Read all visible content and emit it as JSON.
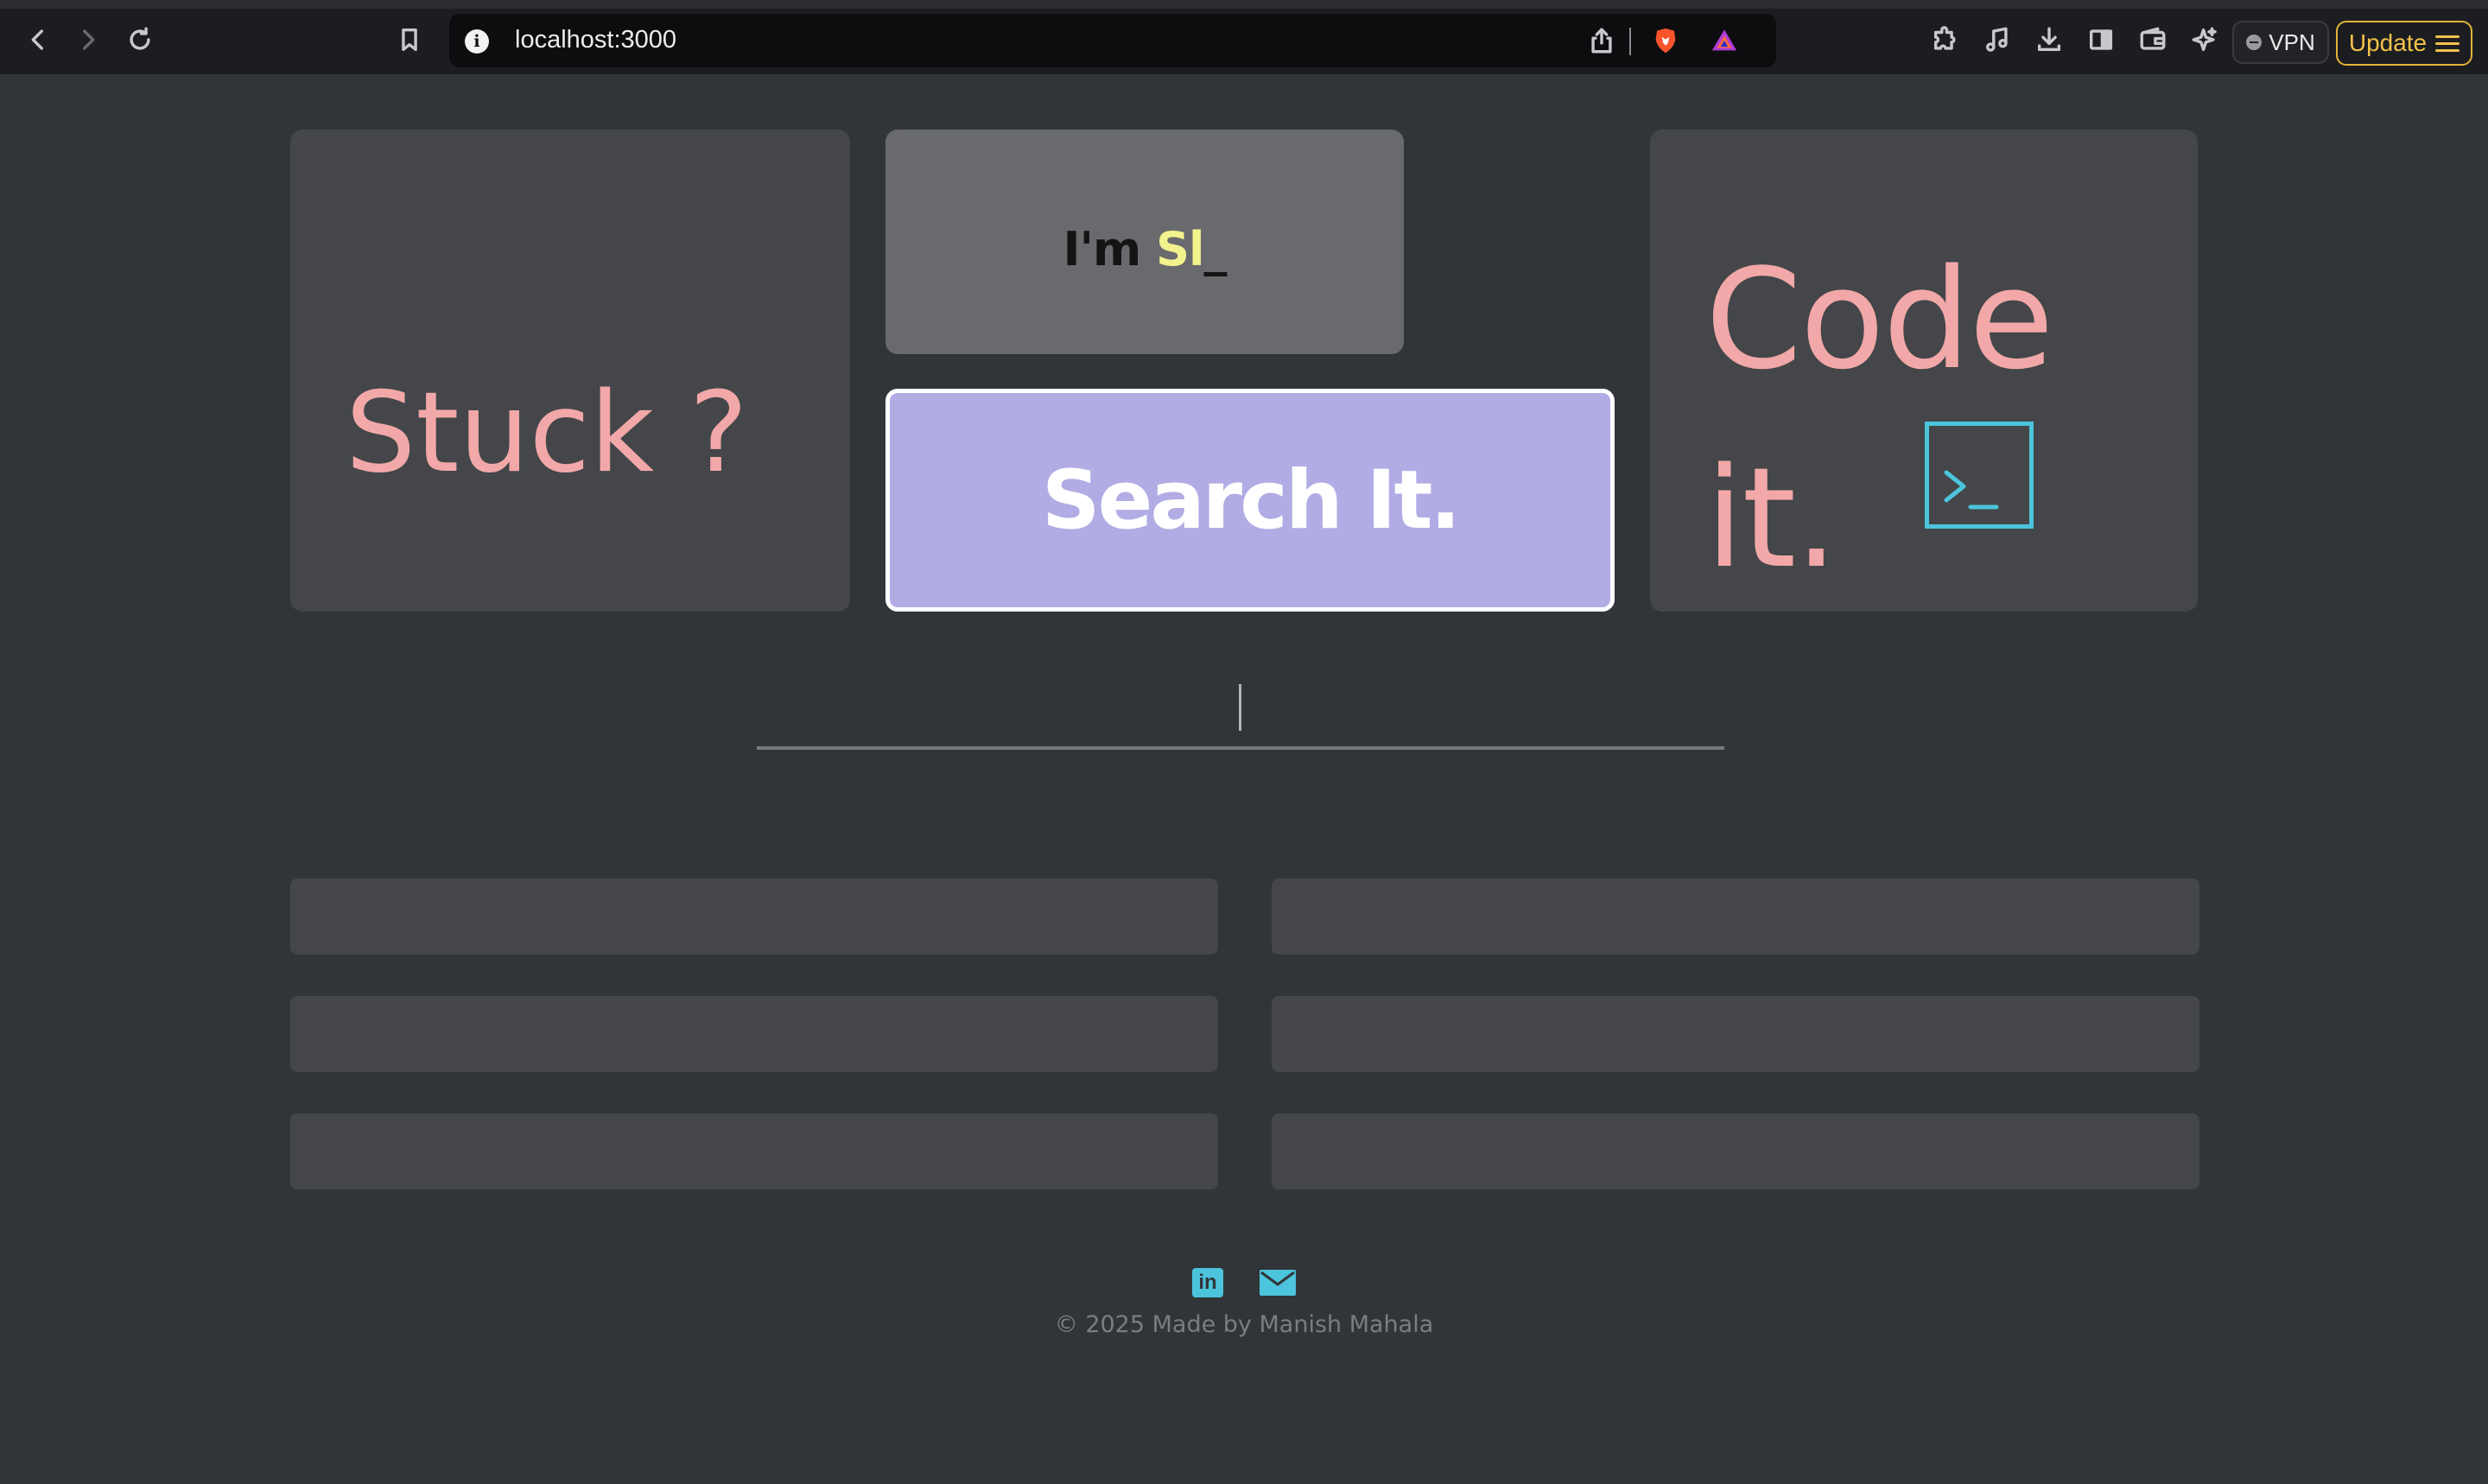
{
  "browser": {
    "url": "localhost:3000",
    "vpn_label": "VPN",
    "update_label": "Update",
    "icons": [
      "back-icon",
      "forward-icon",
      "reload-icon",
      "bookmark-icon",
      "info-icon",
      "share-icon",
      "brave-shield-icon",
      "rewards-icon",
      "extensions-icon",
      "media-icon",
      "downloads-icon",
      "sidebar-icon",
      "wallet-icon",
      "leo-icon",
      "menu-icon"
    ]
  },
  "hero": {
    "stuck_text": "Stuck ?",
    "typing_prefix": "I'm ",
    "typing_highlight": "Sl",
    "typing_cursor": "_",
    "search_button": "Search It.",
    "code_line1": "Code",
    "code_line2": "it.",
    "terminal_icon": "terminal-icon"
  },
  "search": {
    "value": "",
    "placeholder": ""
  },
  "results": [
    "",
    "",
    "",
    "",
    "",
    ""
  ],
  "footer": {
    "linkedin_label": "in",
    "icons": [
      "linkedin-icon",
      "mail-icon"
    ],
    "copyright": "© 2025 Made by Manish Mahala"
  },
  "colors": {
    "background": "#323538",
    "card": "#444649",
    "accent_pink": "#f2a8a8",
    "accent_purple": "#b1ace4",
    "accent_cyan": "#4cc4dc",
    "highlight_yellow": "#f2f28e",
    "update_gold": "#e2b43a"
  }
}
